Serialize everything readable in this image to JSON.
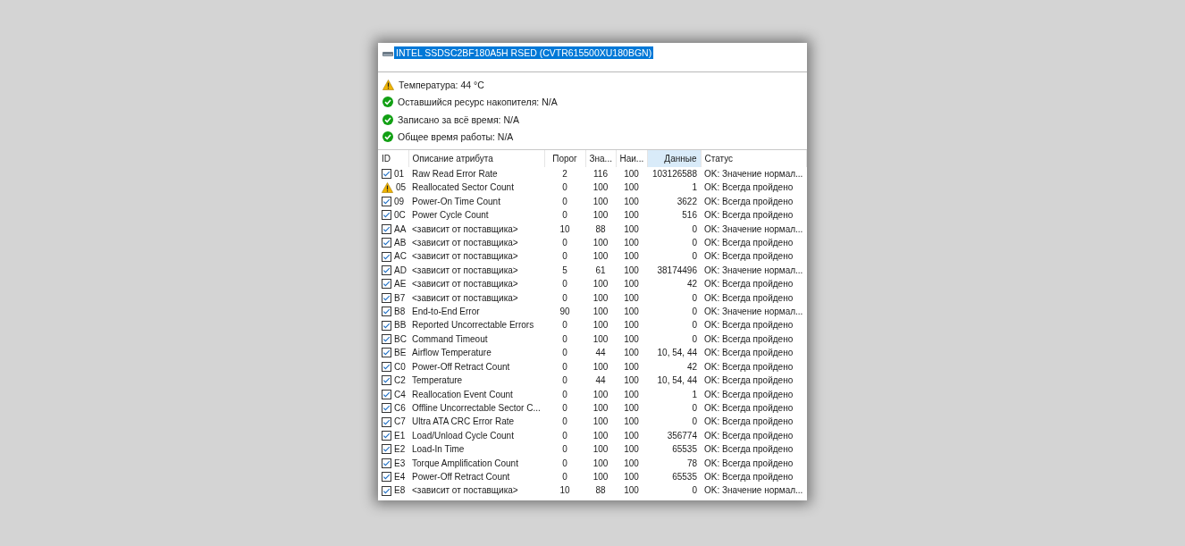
{
  "window": {
    "title": "INTEL SSDSC2BF180A5H RSED (CVTR615500XU180BGN)",
    "title_selected": true
  },
  "summary": [
    {
      "kind": "warning",
      "text": "Температура: 44 °C"
    },
    {
      "kind": "ok",
      "text": "Оставшийся ресурс накопителя: N/A"
    },
    {
      "kind": "ok",
      "text": "Записано за всё время: N/A"
    },
    {
      "kind": "ok",
      "text": "Общее время работы: N/A"
    }
  ],
  "table": {
    "columns": [
      {
        "label": "ID",
        "selected": false
      },
      {
        "label": "Описание атрибута",
        "selected": false
      },
      {
        "label": "Порог",
        "selected": false
      },
      {
        "label": "Зна...",
        "selected": false
      },
      {
        "label": "Наи...",
        "selected": false
      },
      {
        "label": "Данные",
        "selected": true
      },
      {
        "label": "Статус",
        "selected": false
      }
    ],
    "rows": [
      {
        "kind": "check",
        "checked": true,
        "id": "01",
        "name": "Raw Read Error Rate",
        "threshold": "2",
        "value": "116",
        "worst": "100",
        "data": "103126588",
        "status": "OK: Значение нормал..."
      },
      {
        "kind": "warning",
        "id": "05",
        "name": "Reallocated Sector Count",
        "threshold": "0",
        "value": "100",
        "worst": "100",
        "data": "1",
        "status": "OK: Всегда пройдено"
      },
      {
        "kind": "check",
        "checked": true,
        "id": "09",
        "name": "Power-On Time Count",
        "threshold": "0",
        "value": "100",
        "worst": "100",
        "data": "3622",
        "status": "OK: Всегда пройдено"
      },
      {
        "kind": "check",
        "checked": true,
        "id": "0C",
        "name": "Power Cycle Count",
        "threshold": "0",
        "value": "100",
        "worst": "100",
        "data": "516",
        "status": "OK: Всегда пройдено"
      },
      {
        "kind": "check",
        "checked": true,
        "id": "AA",
        "name": "<зависит от поставщика>",
        "threshold": "10",
        "value": "88",
        "worst": "100",
        "data": "0",
        "status": "OK: Значение нормал..."
      },
      {
        "kind": "check",
        "checked": true,
        "id": "AB",
        "name": "<зависит от поставщика>",
        "threshold": "0",
        "value": "100",
        "worst": "100",
        "data": "0",
        "status": "OK: Всегда пройдено"
      },
      {
        "kind": "check",
        "checked": true,
        "id": "AC",
        "name": "<зависит от поставщика>",
        "threshold": "0",
        "value": "100",
        "worst": "100",
        "data": "0",
        "status": "OK: Всегда пройдено"
      },
      {
        "kind": "check",
        "checked": true,
        "id": "AD",
        "name": "<зависит от поставщика>",
        "threshold": "5",
        "value": "61",
        "worst": "100",
        "data": "38174496",
        "status": "OK: Значение нормал..."
      },
      {
        "kind": "check",
        "checked": true,
        "id": "AE",
        "name": "<зависит от поставщика>",
        "threshold": "0",
        "value": "100",
        "worst": "100",
        "data": "42",
        "status": "OK: Всегда пройдено"
      },
      {
        "kind": "check",
        "checked": true,
        "id": "B7",
        "name": "<зависит от поставщика>",
        "threshold": "0",
        "value": "100",
        "worst": "100",
        "data": "0",
        "status": "OK: Всегда пройдено"
      },
      {
        "kind": "check",
        "checked": true,
        "id": "B8",
        "name": "End-to-End Error",
        "threshold": "90",
        "value": "100",
        "worst": "100",
        "data": "0",
        "status": "OK: Значение нормал..."
      },
      {
        "kind": "check",
        "checked": true,
        "id": "BB",
        "name": "Reported Uncorrectable Errors",
        "threshold": "0",
        "value": "100",
        "worst": "100",
        "data": "0",
        "status": "OK: Всегда пройдено"
      },
      {
        "kind": "check",
        "checked": true,
        "id": "BC",
        "name": "Command Timeout",
        "threshold": "0",
        "value": "100",
        "worst": "100",
        "data": "0",
        "status": "OK: Всегда пройдено"
      },
      {
        "kind": "check",
        "checked": true,
        "id": "BE",
        "name": "Airflow Temperature",
        "threshold": "0",
        "value": "44",
        "worst": "100",
        "data": "10, 54, 44",
        "status": "OK: Всегда пройдено"
      },
      {
        "kind": "check",
        "checked": true,
        "id": "C0",
        "name": "Power-Off Retract Count",
        "threshold": "0",
        "value": "100",
        "worst": "100",
        "data": "42",
        "status": "OK: Всегда пройдено"
      },
      {
        "kind": "check",
        "checked": true,
        "id": "C2",
        "name": "Temperature",
        "threshold": "0",
        "value": "44",
        "worst": "100",
        "data": "10, 54, 44",
        "status": "OK: Всегда пройдено"
      },
      {
        "kind": "check",
        "checked": true,
        "id": "C4",
        "name": "Reallocation Event Count",
        "threshold": "0",
        "value": "100",
        "worst": "100",
        "data": "1",
        "status": "OK: Всегда пройдено"
      },
      {
        "kind": "check",
        "checked": true,
        "id": "C6",
        "name": "Offline Uncorrectable Sector C...",
        "threshold": "0",
        "value": "100",
        "worst": "100",
        "data": "0",
        "status": "OK: Всегда пройдено"
      },
      {
        "kind": "check",
        "checked": true,
        "id": "C7",
        "name": "Ultra ATA CRC Error Rate",
        "threshold": "0",
        "value": "100",
        "worst": "100",
        "data": "0",
        "status": "OK: Всегда пройдено"
      },
      {
        "kind": "check",
        "checked": true,
        "id": "E1",
        "name": "Load/Unload Cycle Count",
        "threshold": "0",
        "value": "100",
        "worst": "100",
        "data": "356774",
        "status": "OK: Всегда пройдено"
      },
      {
        "kind": "check",
        "checked": true,
        "id": "E2",
        "name": "Load-In Time",
        "threshold": "0",
        "value": "100",
        "worst": "100",
        "data": "65535",
        "status": "OK: Всегда пройдено"
      },
      {
        "kind": "check",
        "checked": true,
        "id": "E3",
        "name": "Torque Amplification Count",
        "threshold": "0",
        "value": "100",
        "worst": "100",
        "data": "78",
        "status": "OK: Всегда пройдено"
      },
      {
        "kind": "check",
        "checked": true,
        "id": "E4",
        "name": "Power-Off Retract Count",
        "threshold": "0",
        "value": "100",
        "worst": "100",
        "data": "65535",
        "status": "OK: Всегда пройдено"
      },
      {
        "kind": "check",
        "checked": true,
        "id": "E8",
        "name": "<зависит от поставщика>",
        "threshold": "10",
        "value": "88",
        "worst": "100",
        "data": "0",
        "status": "OK: Значение нормал..."
      }
    ]
  }
}
